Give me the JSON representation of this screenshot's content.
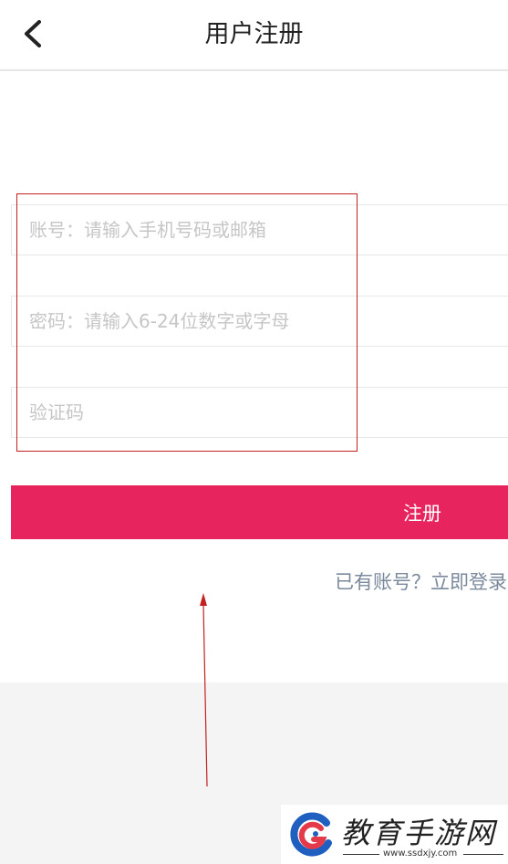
{
  "header": {
    "title": "用户注册",
    "back_icon": "chevron-left-icon"
  },
  "form": {
    "account_placeholder": "账号：请输入手机号码或邮箱",
    "password_placeholder": "密码：请输入6-24位数字或字母",
    "code_placeholder": "验证码",
    "account_value": "",
    "password_value": "",
    "code_value": ""
  },
  "register_button": {
    "label": "注册"
  },
  "login_link": {
    "label": "已有账号？立即登录"
  },
  "watermark": {
    "title": "教育手游网",
    "url": "www.ssdxjy.com"
  },
  "colors": {
    "accent": "#e8245e",
    "link": "#7a8a9c",
    "annotation": "#c42020",
    "background_gray": "#f4f4f4"
  }
}
